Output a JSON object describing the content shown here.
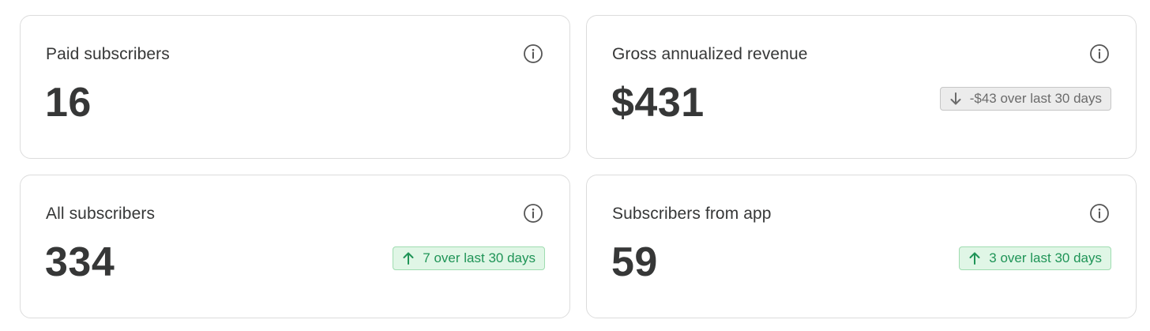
{
  "cards": [
    {
      "label": "Paid subscribers",
      "value": "16",
      "info_icon": "info-circle-icon"
    },
    {
      "label": "Gross annualized revenue",
      "value": "$431",
      "info_icon": "info-circle-icon",
      "delta": {
        "direction": "down",
        "text": "-$43 over last 30 days",
        "icon": "arrow-down-icon"
      }
    },
    {
      "label": "All subscribers",
      "value": "334",
      "info_icon": "info-circle-icon",
      "delta": {
        "direction": "up",
        "text": "7 over last 30 days",
        "icon": "arrow-up-icon"
      }
    },
    {
      "label": "Subscribers from app",
      "value": "59",
      "info_icon": "info-circle-icon",
      "delta": {
        "direction": "up",
        "text": "3 over last 30 days",
        "icon": "arrow-up-icon"
      }
    }
  ],
  "colors": {
    "text": "#363737",
    "border": "#dcdcdc",
    "positive": "#1f9457",
    "positive_bg": "#e0f6e6",
    "neutral": "#6b6b6b",
    "neutral_bg": "#ececec"
  }
}
